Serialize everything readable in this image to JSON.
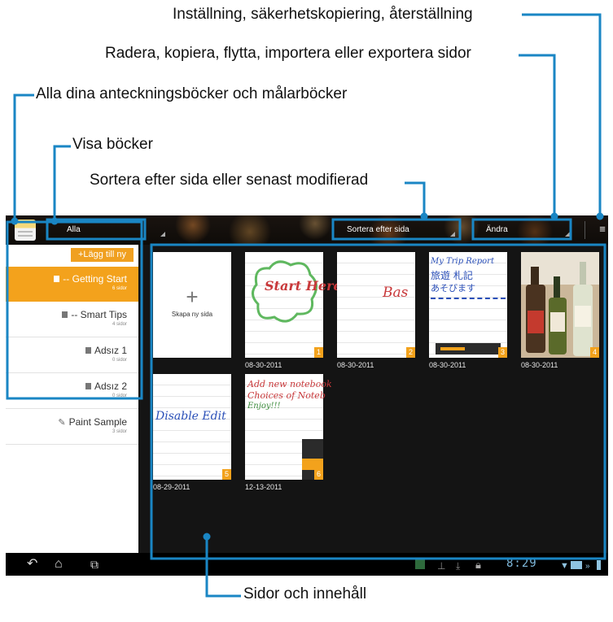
{
  "callouts": {
    "settings": "Inställning, säkerhetskopiering, återställning",
    "manage_pages": "Radera, kopiera, flytta, importera eller exportera sidor",
    "all_books": "Alla dina anteckningsböcker och målarböcker",
    "show_books": "Visa böcker",
    "sort": "Sortera efter sida eller senast modifierad",
    "pages_content": "Sidor och innehåll"
  },
  "topbar": {
    "filter_value": "Alla",
    "sort_value": "Sortera efter sida",
    "edit_value": "Ändra",
    "menu_icon": "overflow-menu-icon"
  },
  "sidebar": {
    "add_new": "+Lägg till ny",
    "notebooks": [
      {
        "title": "-- Getting Start",
        "sub": "6 sidor",
        "selected": true
      },
      {
        "title": "-- Smart Tips",
        "sub": "4 sidor"
      },
      {
        "title": "Adsız 1",
        "sub": "0 sidor"
      },
      {
        "title": "Adsız 2",
        "sub": "0 sidor"
      },
      {
        "title": "Paint Sample",
        "sub": "3 sidor"
      }
    ]
  },
  "pages": {
    "create_label": "Skapa ny sida",
    "items": [
      {
        "num": "1",
        "date": "08-30-2011",
        "text": "Start Here!"
      },
      {
        "num": "2",
        "date": "08-30-2011",
        "text": "Bas"
      },
      {
        "num": "3",
        "date": "08-30-2011",
        "text": "My Trip Report"
      },
      {
        "num": "4",
        "date": "08-30-2011",
        "text": ""
      },
      {
        "num": "5",
        "date": "08-29-2011",
        "text": "Disable Edit"
      },
      {
        "num": "6",
        "date": "12-13-2011",
        "text": "Add new notebook"
      }
    ]
  },
  "statusbar": {
    "clock": "8:29"
  },
  "colors": {
    "accent": "#f3a21c",
    "callout_line": "#1a86c4"
  }
}
